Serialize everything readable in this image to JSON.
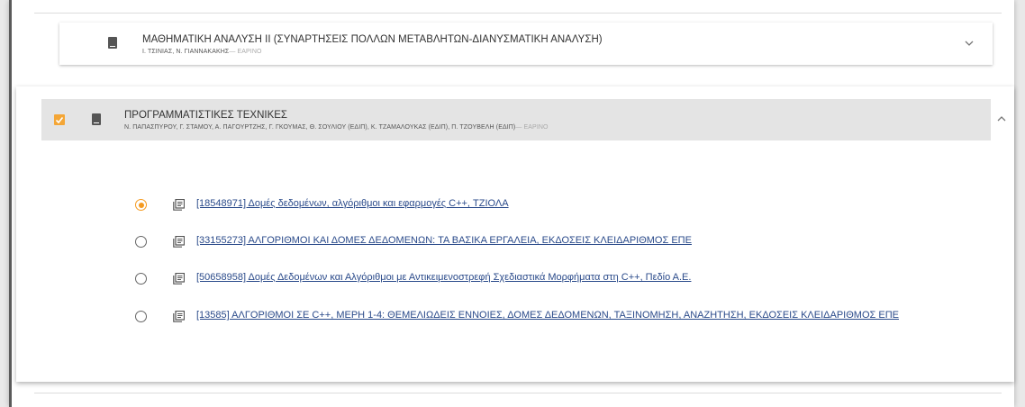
{
  "course_1": {
    "title": "ΜΑΘΗΜΑΤΙΚΗ ΑΝΑΛΥΣΗ ΙΙ (ΣΥΝΑΡΤΗΣΕΙΣ ΠΟΛΛΩΝ ΜΕΤΑΒΛΗΤΩΝ-ΔΙΑΝΥΣΜΑΤΙΚΗ ΑΝΑΛΥΣΗ)",
    "instructors": "Ι. ΤΣΙΝΙΑΣ, Ν. ΓΙΑΝΝΑΚΑΚΗΣ",
    "term": "— ΕΑΡΙΝΟ",
    "icon": "book-icon",
    "toggle_icon": "chevron-down-icon"
  },
  "course_2": {
    "title": "ΠΡΟΓΡΑΜΜΑΤΙΣΤΙΚΕΣ ΤΕΧΝΙΚΕΣ",
    "instructors": "Ν. ΠΑΠΑΣΠΥΡΟΥ, Γ. ΣΤΑΜΟΥ, Α. ΠΑΓΟΥΡΤΖΗΣ, Γ. ΓΚΟΥΜΑΣ, Θ. ΣΟΥΛΙΟΥ (ΕΔΙΠ), Κ. ΤΖΑΜΑΛΟΥΚΑΣ (ΕΔΙΠ), Π. ΤΖΟΥΒΕΛΗ (ΕΔΙΠ)",
    "term": "— ΕΑΡΙΝΟ",
    "checked": true,
    "icon": "book-icon",
    "toggle_icon": "chevron-up-icon",
    "options": [
      {
        "label": "[18548971] Δομές δεδομένων, αλγόριθμοι και εφαρμογές C++, ΤΖΙΟΛΑ",
        "selected": true
      },
      {
        "label": "[33155273] ΑΛΓΟΡΙΘΜΟΙ ΚΑΙ ΔΟΜΕΣ ΔΕΔΟΜΕΝΩΝ: ΤΑ ΒΑΣΙΚΑ ΕΡΓΑΛΕΙΑ, ΕΚΔΟΣΕΙΣ ΚΛΕΙΔΑΡΙΘΜΟΣ ΕΠΕ",
        "selected": false
      },
      {
        "label": "[50658958] Δομές Δεδομένων και Αλγόριθμοι με Αντικειμενοστρεφή Σχεδιαστικά Μορφήματα στη C++, Πεδίο Α.Ε.",
        "selected": false
      },
      {
        "label": "[13585] ΑΛΓΟΡΙΘΜΟΙ ΣΕ C++, ΜΕΡΗ 1-4: ΘΕΜΕΛΙΩΔΕΙΣ ΕΝΝΟΙΕΣ, ΔΟΜΕΣ ΔΕΔΟΜΕΝΩΝ, ΤΑΞΙΝΟΜΗΣΗ, ΑΝΑΖΗΤΗΣΗ, ΕΚΔΟΣΕΙΣ ΚΛΕΙΔΑΡΙΘΜΟΣ ΕΠΕ",
        "selected": false
      }
    ]
  },
  "colors": {
    "accent": "#f49a20",
    "link": "#2a4a8a",
    "header_bg": "#e4e4e4"
  }
}
